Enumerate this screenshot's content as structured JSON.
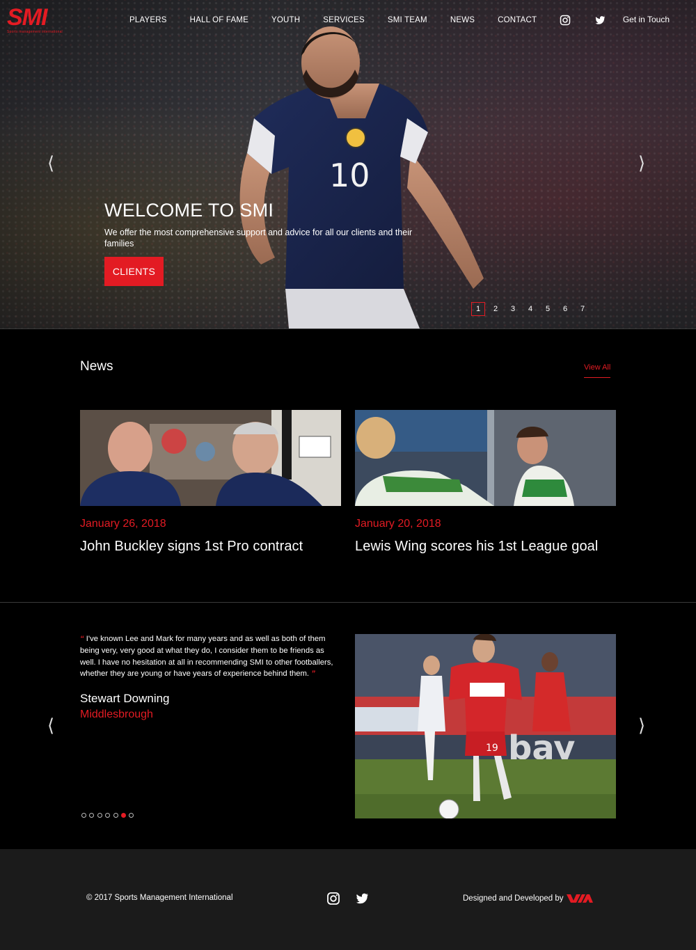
{
  "brand": {
    "logo_text": "SMI",
    "logo_tagline": "Sports management international",
    "accent_color": "#e31b23"
  },
  "nav": {
    "items": [
      "PLAYERS",
      "HALL OF FAME",
      "YOUTH",
      "SERVICES",
      "SMI TEAM",
      "NEWS",
      "CONTACT"
    ],
    "social_icons": [
      "instagram-icon",
      "twitter-icon"
    ],
    "cta": "Get in Touch"
  },
  "hero": {
    "title": "WELCOME TO SMI",
    "subtitle": "We offer the most comprehensive support and advice for all our clients and their families",
    "button_label": "CLIENTS",
    "prev_arrow": "⟨",
    "next_arrow": "⟩",
    "slides": [
      "1",
      "2",
      "3",
      "4",
      "5",
      "6",
      "7"
    ],
    "active_slide": "1",
    "shirt_number": "10"
  },
  "news": {
    "heading": "News",
    "view_all": "View All",
    "articles": [
      {
        "date": "January 26, 2018",
        "headline": "John Buckley signs 1st Pro contract"
      },
      {
        "date": "January 20, 2018",
        "headline": "Lewis Wing scores his 1st League goal"
      }
    ]
  },
  "testimonial": {
    "open_quote": "“",
    "close_quote": "”",
    "text": "I've known Lee and Mark for many years and as well as both of them being very, very good at what they do, I consider them to be friends as well. I have no hesitation at all in recommending SMI to other footballers, whether they are young or have years of experience behind them.",
    "name": "Stewart Downing",
    "club": "Middlesbrough",
    "prev_arrow": "⟨",
    "next_arrow": "⟩",
    "dot_count": 7,
    "active_dot": 6,
    "shirt_number": "19"
  },
  "footer": {
    "copyright": "© 2017 Sports Management International",
    "social_icons": [
      "instagram-icon",
      "twitter-icon"
    ],
    "credit": "Designed and Developed by"
  }
}
